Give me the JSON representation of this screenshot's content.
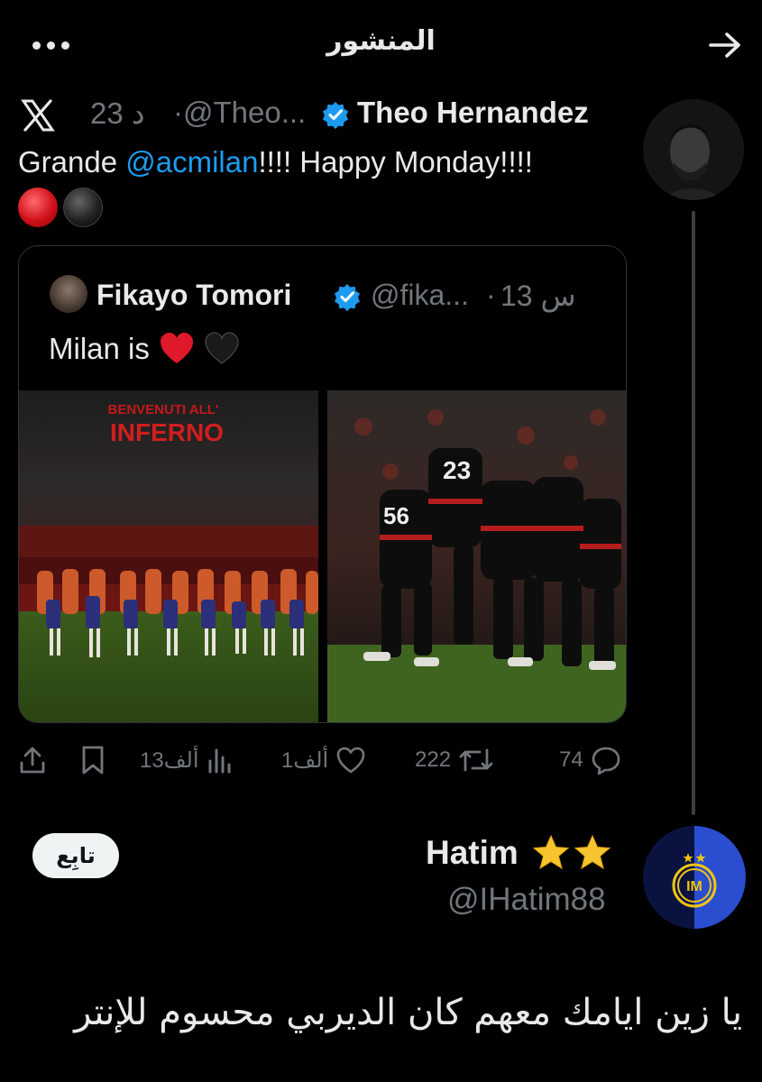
{
  "header": {
    "title": "المنشور",
    "back_icon": "arrow-right-icon",
    "more_icon": "more-dots-icon"
  },
  "tweet": {
    "author_name": "Theo Hernandez",
    "handle": "@Theo...",
    "separator": "·",
    "time": "23 د",
    "text_before": "Grande ",
    "mention": "@acmilan",
    "text_after": "!!!! Happy Monday!!!!",
    "emojis": [
      "red-circle",
      "black-circle"
    ]
  },
  "quote": {
    "author_name": "Fikayo Tomori",
    "handle": "@fika...",
    "separator": "·",
    "time": "13 س",
    "text": "Milan is",
    "banner_line1": "BENVENUTI ALL'",
    "banner_line2": "INFERNO",
    "jersey_a": "23",
    "jersey_b": "56"
  },
  "actions": {
    "replies": "74",
    "reposts": "222",
    "likes": "1ألف",
    "views": "13ألف"
  },
  "reply": {
    "author_name": "Hatim",
    "handle": "@IHatim88",
    "follow_label": "تابِع",
    "text": "يا زين ايامك معهم كان الديربي محسوم للإنتر"
  },
  "colors": {
    "accent": "#1d9bf0",
    "background": "#000000",
    "muted": "#71767b",
    "star": "#f7c431"
  }
}
